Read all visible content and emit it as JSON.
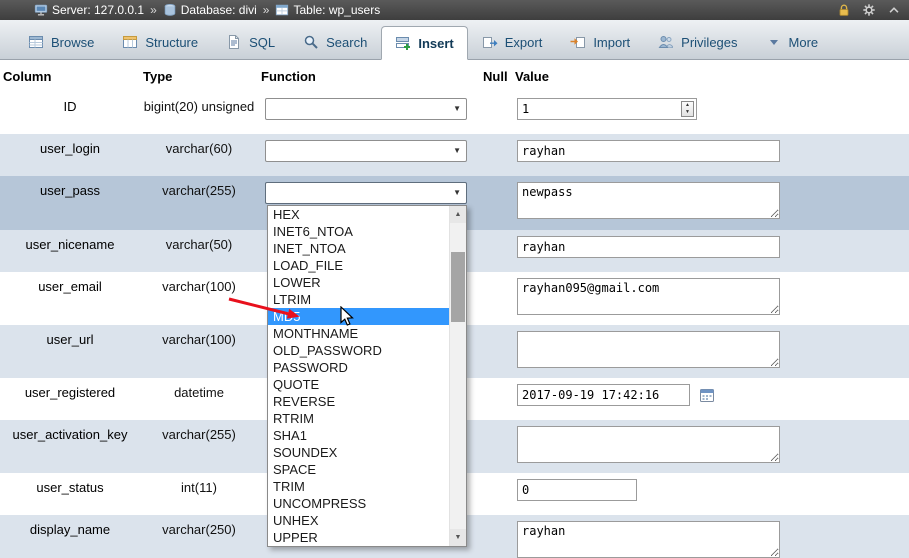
{
  "topbar": {
    "separator": "»",
    "breadcrumb": [
      {
        "label": "Server: 127.0.0.1"
      },
      {
        "label": "Database: divi"
      },
      {
        "label": "Table: wp_users"
      }
    ]
  },
  "tabs": {
    "active": "Insert",
    "items": [
      {
        "label": "Browse"
      },
      {
        "label": "Structure"
      },
      {
        "label": "SQL"
      },
      {
        "label": "Search"
      },
      {
        "label": "Insert"
      },
      {
        "label": "Export"
      },
      {
        "label": "Import"
      },
      {
        "label": "Privileges"
      },
      {
        "label": "More"
      }
    ]
  },
  "insert_form": {
    "headers": [
      "Column",
      "Type",
      "Function",
      "Null",
      "Value"
    ],
    "rows": [
      {
        "column": "ID",
        "type": "bigint(20) unsigned",
        "value": "1"
      },
      {
        "column": "user_login",
        "type": "varchar(60)",
        "value": "rayhan"
      },
      {
        "column": "user_pass",
        "type": "varchar(255)",
        "value": "newpass"
      },
      {
        "column": "user_nicename",
        "type": "varchar(50)",
        "value": "rayhan"
      },
      {
        "column": "user_email",
        "type": "varchar(100)",
        "value": "rayhan095@gmail.com"
      },
      {
        "column": "user_url",
        "type": "varchar(100)",
        "value": ""
      },
      {
        "column": "user_registered",
        "type": "datetime",
        "value": "2017-09-19 17:42:16"
      },
      {
        "column": "user_activation_key",
        "type": "varchar(255)",
        "value": ""
      },
      {
        "column": "user_status",
        "type": "int(11)",
        "value": "0"
      },
      {
        "column": "display_name",
        "type": "varchar(250)",
        "value": "rayhan"
      }
    ]
  },
  "function_dropdown": {
    "highlighted": "MD5",
    "items": [
      "HEX",
      "INET6_NTOA",
      "INET_NTOA",
      "LOAD_FILE",
      "LOWER",
      "LTRIM",
      "MD5",
      "MONTHNAME",
      "OLD_PASSWORD",
      "PASSWORD",
      "QUOTE",
      "REVERSE",
      "RTRIM",
      "SHA1",
      "SOUNDEX",
      "SPACE",
      "TRIM",
      "UNCOMPRESS",
      "UNHEX",
      "UPPER"
    ]
  },
  "colors": {
    "dropdown_highlight": "#3297fd",
    "row_stripe": "#dbe3ec",
    "row_active": "#b6c6d8",
    "annotation_arrow": "#e8101c",
    "tab_text": "#1c4f75",
    "topbar_bg": "#454545"
  }
}
